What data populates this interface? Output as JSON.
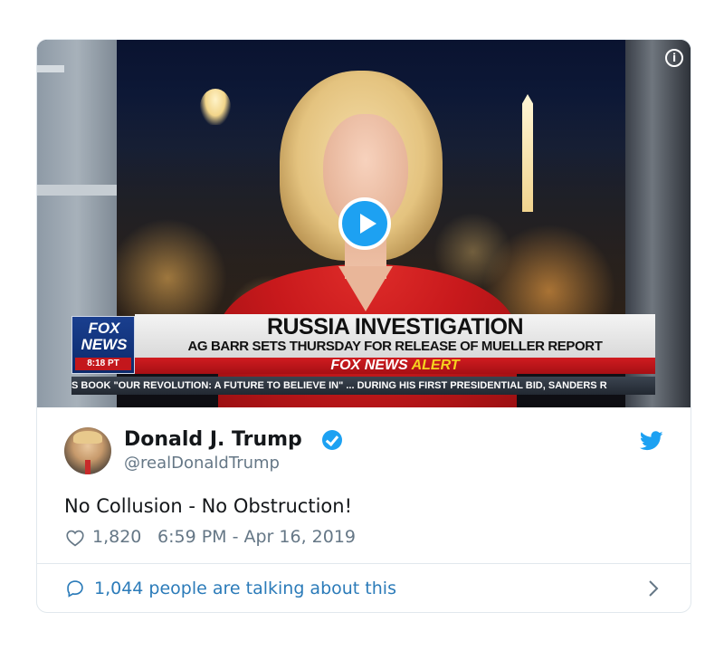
{
  "video": {
    "info_icon": "info-icon",
    "play_icon": "play-icon",
    "chyron": {
      "logo_line1": "FOX",
      "logo_line2": "NEWS",
      "time": "8:18 PT",
      "headline": "RUSSIA INVESTIGATION",
      "subheadline": "AG BARR SETS THURSDAY FOR RELEASE OF MUELLER REPORT",
      "alert_brand": "FOX NEWS",
      "alert_word": "ALERT",
      "ticker": "S BOOK \"OUR REVOLUTION: A FUTURE TO BELIEVE IN\" ...   DURING HIS FIRST PRESIDENTIAL BID, SANDERS R"
    }
  },
  "tweet": {
    "author_name": "Donald J. Trump",
    "handle": "@realDonaldTrump",
    "verified": true,
    "text": "No Collusion - No Obstruction!",
    "likes": "1,820",
    "timestamp": "6:59 PM - Apr 16, 2019",
    "talking": "1,044 people are talking about this"
  },
  "colors": {
    "twitter_blue": "#1da1f2",
    "link_blue": "#2b7bb9",
    "muted_text": "#657786",
    "fox_red": "#c3171c"
  }
}
